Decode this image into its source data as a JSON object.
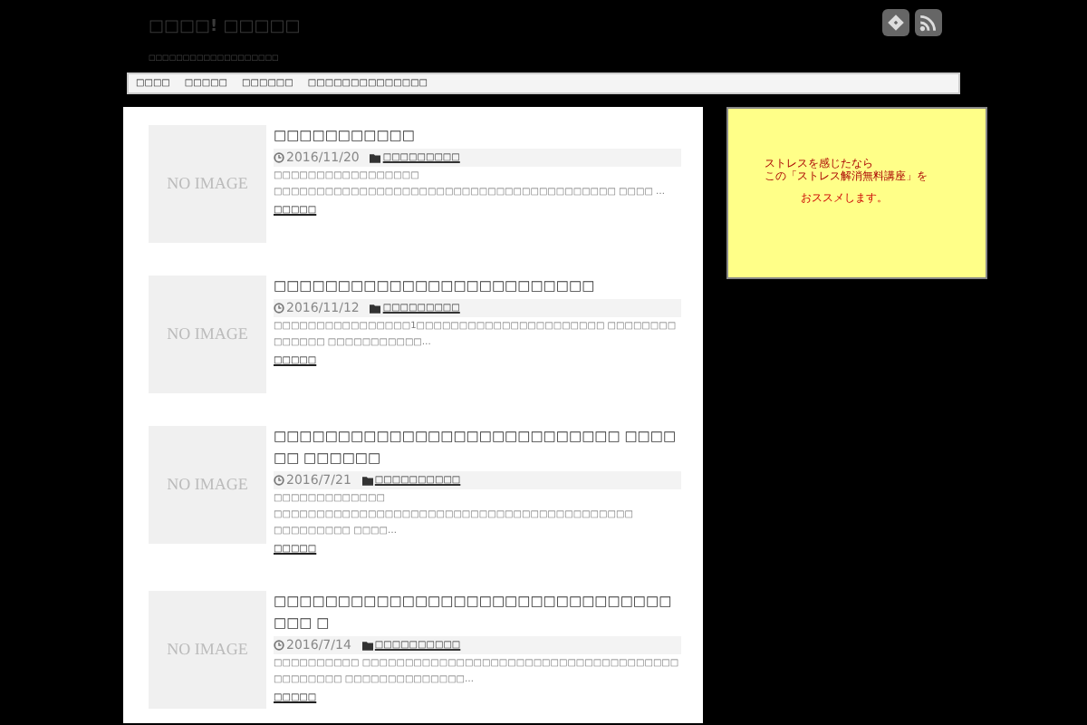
{
  "header": {
    "site_title": "□□□□! □□□□□",
    "tagline": "□□□□□□□□□□□□□□□□□□□"
  },
  "nav": {
    "items": [
      "□□□□",
      "□□□□□",
      "□□□□□□",
      "□□□□□□□□□□□□□□"
    ]
  },
  "posts": [
    {
      "image_label": "NO IMAGE",
      "title": "□□□□□□□□□□□",
      "date": "2016/11/20",
      "category": "□□□□□□□□□",
      "excerpt": "□□□□□□□□□□□□□□□□□ □□□□□□□□□□□□□□□□□□□□□□□□□□□□□□□□□□□□□□□□ □□□□ …",
      "read_more": "□□□□□"
    },
    {
      "image_label": "NO IMAGE",
      "title": "□□□□□□□□□□□□□□□□□□□□□□□□□",
      "date": "2016/11/12",
      "category": "□□□□□□□□□",
      "excerpt": "□□□□□□□□□□□□□□□□1□□□□□□□□□□□□□□□□□□□□□□ □□□□□□□□ □□□□□□ □□□□□□□□□□□…",
      "read_more": "□□□□□"
    },
    {
      "image_label": "NO IMAGE",
      "title": "□□□□□□□□□□□□□□□□□□□□□□□□□□□ □□□□□□ □□□□□□",
      "date": "2016/7/21",
      "category": "□□□□□□□□□□",
      "excerpt": "□□□□□□□□□□□□□ □□□□□□□□□□□□□□□□□□□□□□□□□□□□□□□□□□□□□□□□□□ □□□□□□□□□ □□□□…",
      "read_more": "□□□□□"
    },
    {
      "image_label": "NO IMAGE",
      "title": "□□□□□□□□□□□□□□□□□□□□□□□□□□□□□□□□□□ □",
      "date": "2016/7/14",
      "category": "□□□□□□□□□□",
      "excerpt": "□□□□□□□□□□ □□□□□□□□□□□□□□□□□□□□□□□□□□□□□□□□□□□□□ □□□□□□□□ □□□□□□□□□□□□□□…",
      "read_more": "□□□□□"
    }
  ],
  "sidebar": {
    "ad_lines": [
      "ストレスを感じたなら",
      "この「ストレス解消無料講座」を",
      "おススメします。"
    ]
  }
}
